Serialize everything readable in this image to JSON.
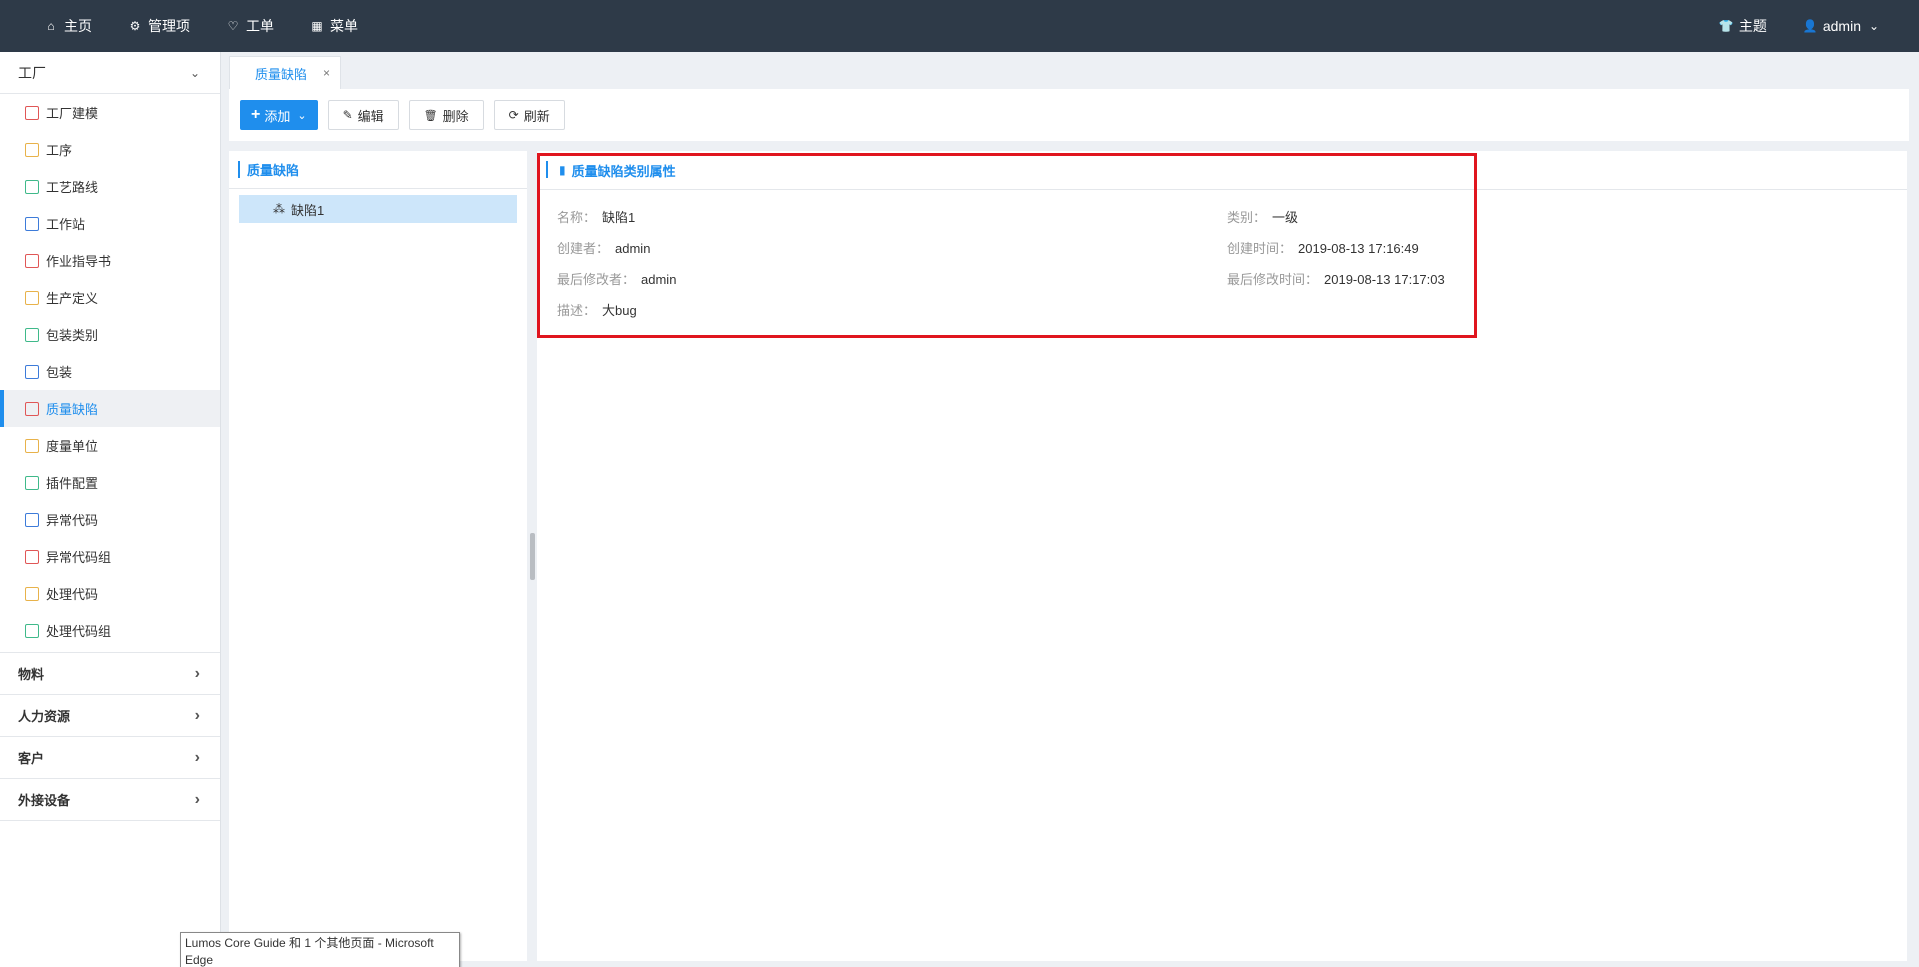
{
  "topnav": {
    "items": [
      {
        "label": "主页",
        "icon": "home-icon"
      },
      {
        "label": "管理项",
        "icon": "gear-icon"
      },
      {
        "label": "工单",
        "icon": "workorder-icon"
      },
      {
        "label": "菜单",
        "icon": "grid-icon"
      }
    ],
    "theme": {
      "label": "主题",
      "icon": "shirt-icon"
    },
    "user": {
      "label": "admin",
      "icon": "user-icon"
    }
  },
  "sidebar": {
    "factory_group": "工厂",
    "items": [
      {
        "label": "工厂建模",
        "color": "#e05656"
      },
      {
        "label": "工序",
        "color": "#e8b24a"
      },
      {
        "label": "工艺路线",
        "color": "#3fb98a"
      },
      {
        "label": "工作站",
        "color": "#3d7bd9"
      },
      {
        "label": "作业指导书",
        "color": "#e05656"
      },
      {
        "label": "生产定义",
        "color": "#e8b24a"
      },
      {
        "label": "包装类别",
        "color": "#3fb98a"
      },
      {
        "label": "包装",
        "color": "#3d7bd9"
      },
      {
        "label": "质量缺陷",
        "color": "#e05656",
        "active": true
      },
      {
        "label": "度量单位",
        "color": "#e8b24a"
      },
      {
        "label": "插件配置",
        "color": "#3fb98a"
      },
      {
        "label": "异常代码",
        "color": "#3d7bd9"
      },
      {
        "label": "异常代码组",
        "color": "#e05656"
      },
      {
        "label": "处理代码",
        "color": "#e8b24a"
      },
      {
        "label": "处理代码组",
        "color": "#3fb98a"
      }
    ],
    "collapsed_groups": [
      "物料",
      "人力资源",
      "客户",
      "外接设备"
    ]
  },
  "tabs": [
    {
      "label": "质量缺陷",
      "close": "×"
    }
  ],
  "toolbar": {
    "add": "添加",
    "edit": "编辑",
    "delete": "删除",
    "refresh": "刷新"
  },
  "tree": {
    "title": "质量缺陷",
    "node": "缺陷1"
  },
  "detail": {
    "title": "质量缺陷类别属性",
    "name_label": "名称：",
    "name_value": "缺陷1",
    "category_label": "类别：",
    "category_value": "一级",
    "creator_label": "创建者：",
    "creator_value": "admin",
    "created_label": "创建时间：",
    "created_value": "2019-08-13 17:16:49",
    "modifier_label": "最后修改者：",
    "modifier_value": "admin",
    "modified_label": "最后修改时间：",
    "modified_value": "2019-08-13 17:17:03",
    "desc_label": "描述：",
    "desc_value": "大bug"
  },
  "tooltip": "Lumos Core Guide 和 1 个其他页面 - Microsoft Edge",
  "colors": {
    "accent": "#1f8eed",
    "topbar": "#2e3a48",
    "highlight": "#e0151e"
  }
}
